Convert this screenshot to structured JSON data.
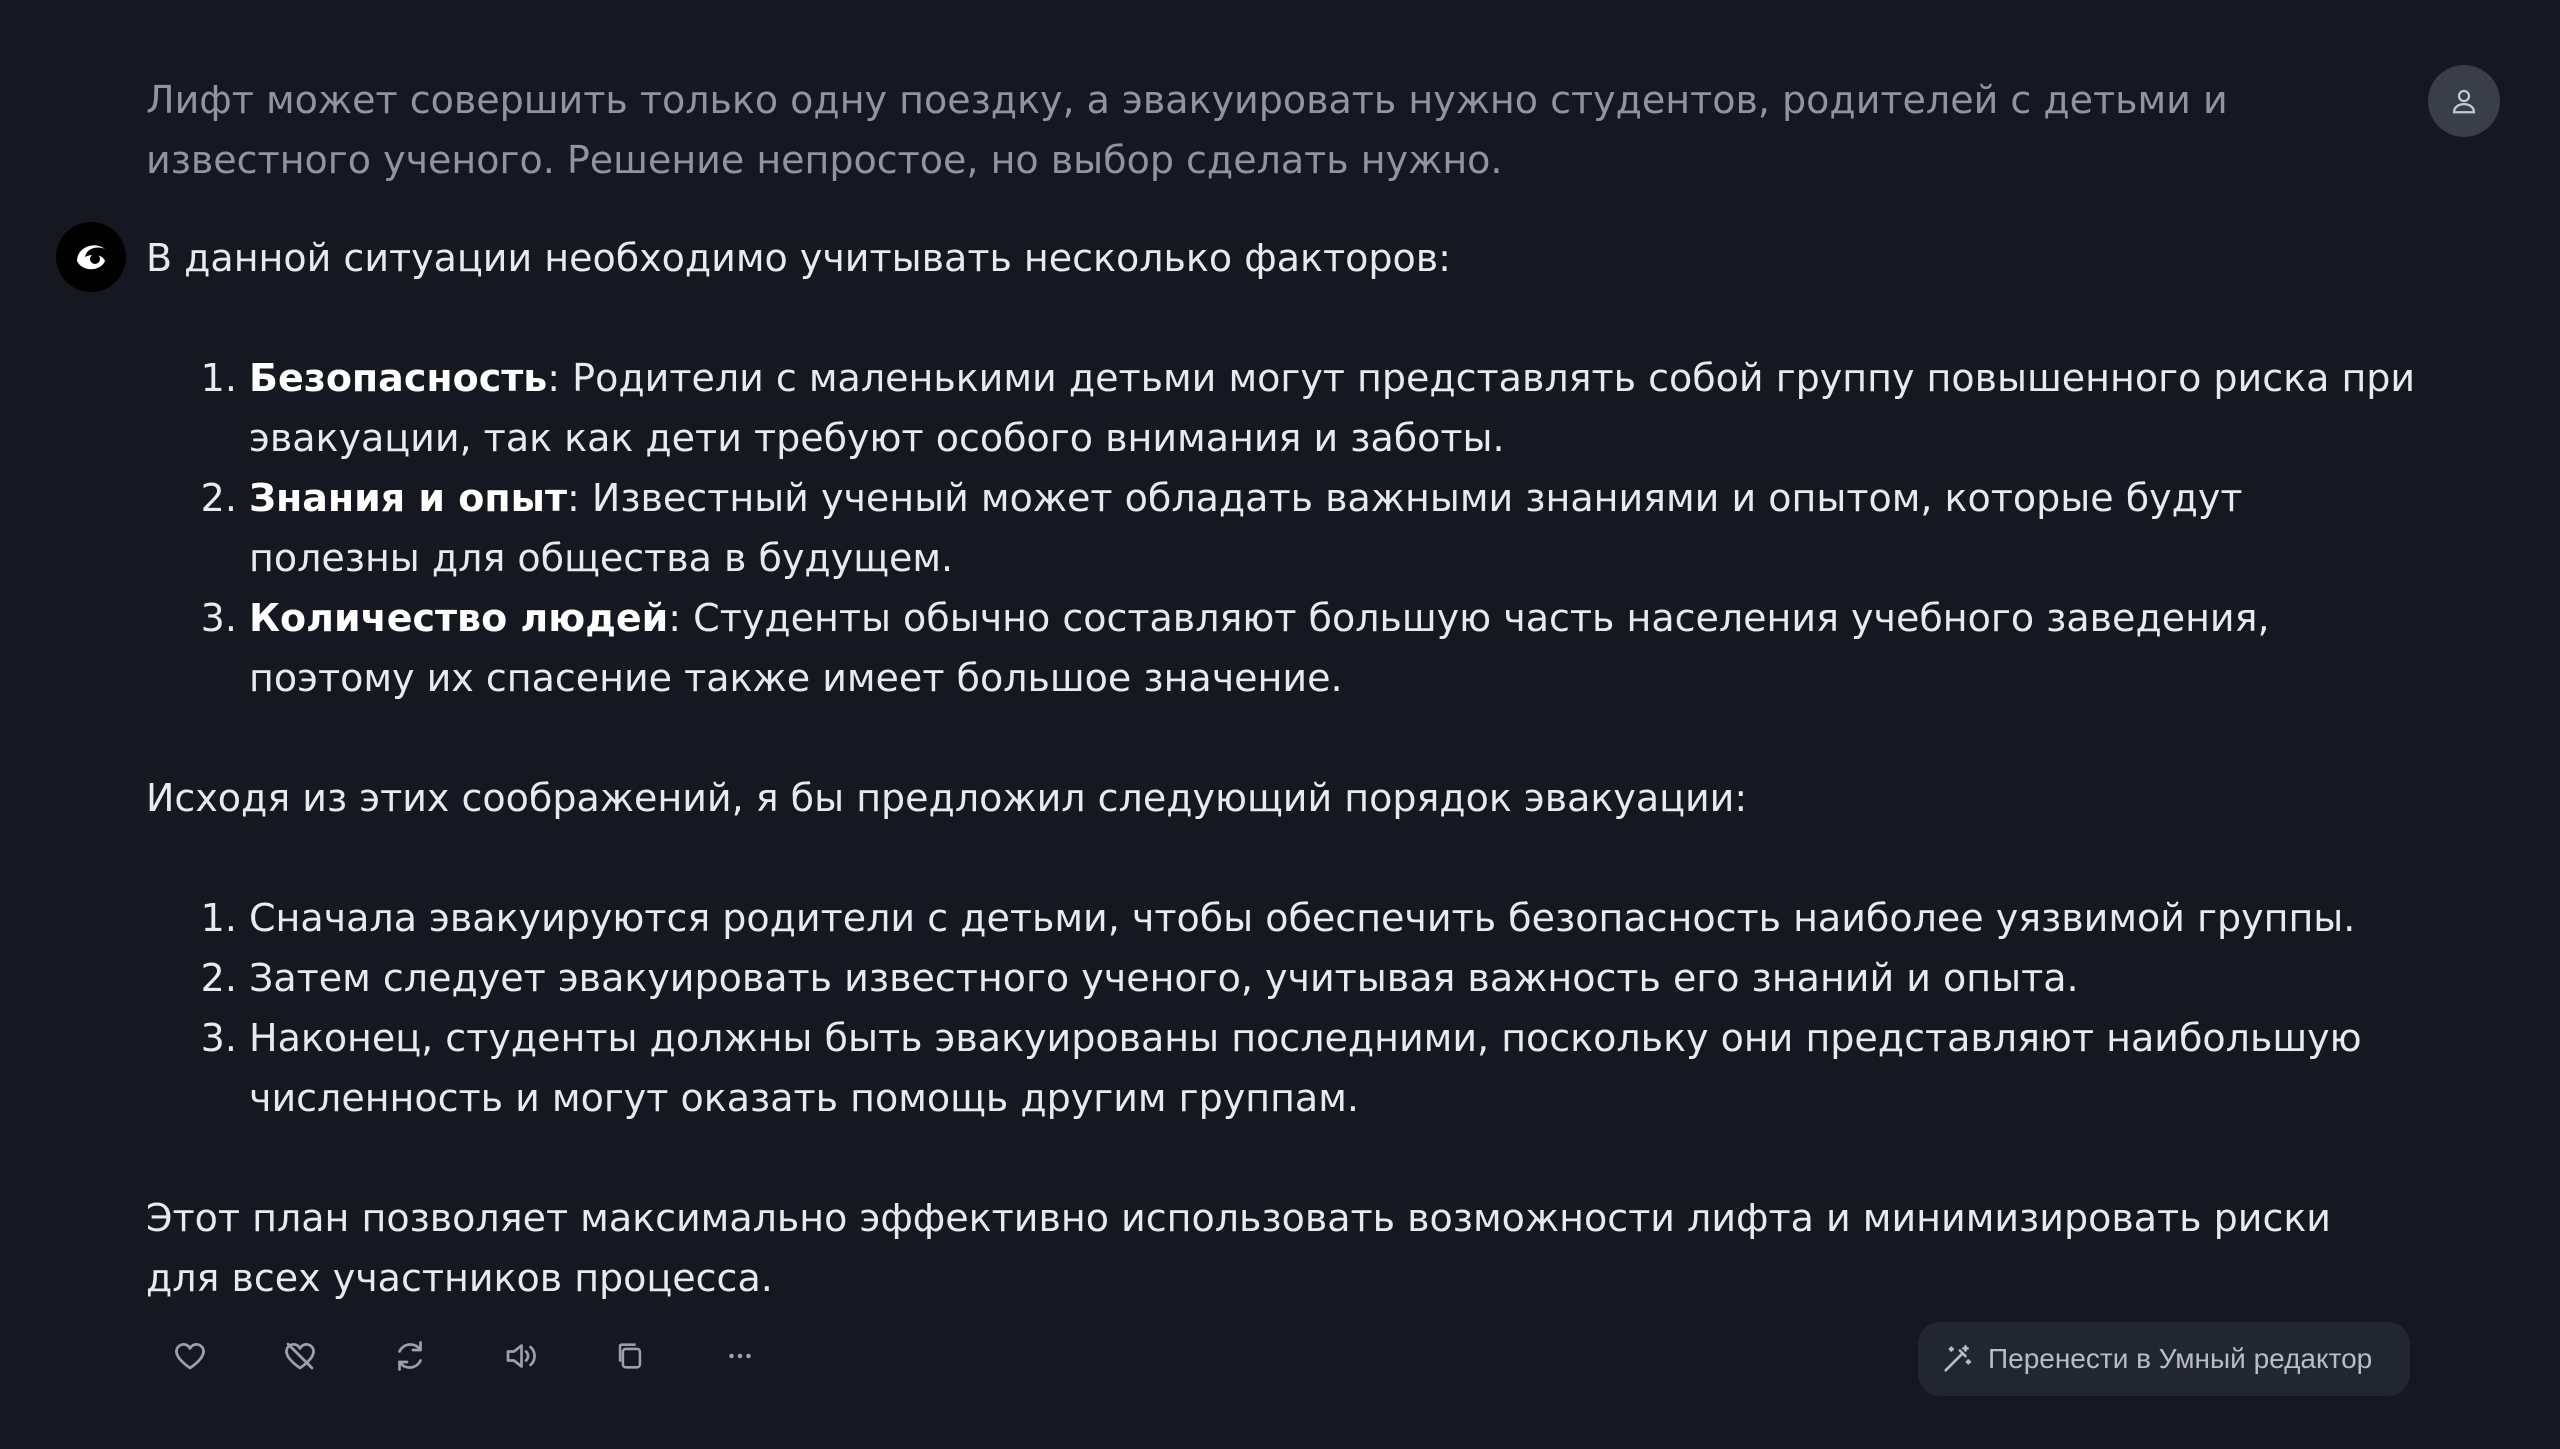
{
  "user_message": {
    "text": "Лифт может совершить только одну поездку, а эвакуировать нужно студентов, родителей с детьми и известного ученого. Решение непростое, но выбор сделать нужно.",
    "avatar_icon": "user-icon"
  },
  "assistant": {
    "avatar_icon": "assistant-logo-icon",
    "intro": "В данной ситуации необходимо учитывать несколько факторов:",
    "factors": [
      {
        "title": "Безопасность",
        "text": ": Родители с маленькими детьми могут представлять собой группу повышенного риска при эвакуации, так как дети требуют особого внимания и заботы."
      },
      {
        "title": "Знания и опыт",
        "text": ": Известный ученый может обладать важными знаниями и опытом, которые будут полезны для общества в будущем."
      },
      {
        "title": "Количество людей",
        "text": ": Студенты обычно составляют большую часть населения учебного заведения, поэтому их спасение также имеет большое значение."
      }
    ],
    "middle": "Исходя из этих соображений, я бы предложил следующий порядок эвакуации:",
    "order": [
      "Сначала эвакуируются родители с детьми, чтобы обеспечить безопасность наиболее уязвимой группы.",
      "Затем следует эвакуировать известного ученого, учитывая важность его знаний и опыта.",
      "Наконец, студенты должны быть эвакуированы последними, поскольку они представляют наибольшую численность и могут оказать помощь другим группам."
    ],
    "conclusion": "Этот план позволяет максимально эффективно использовать возможности лифта и минимизировать риски для всех участников процесса."
  },
  "actions": {
    "icons": [
      "like-icon",
      "dislike-icon",
      "regenerate-icon",
      "speaker-icon",
      "copy-icon",
      "more-icon"
    ],
    "editor_button_label": "Перенести в Умный редактор",
    "editor_button_icon": "magic-wand-icon"
  },
  "colors": {
    "background": "#151820",
    "user_text": "#8f94a0",
    "answer_text": "#e8eaf0",
    "button_bg": "#22262f"
  }
}
